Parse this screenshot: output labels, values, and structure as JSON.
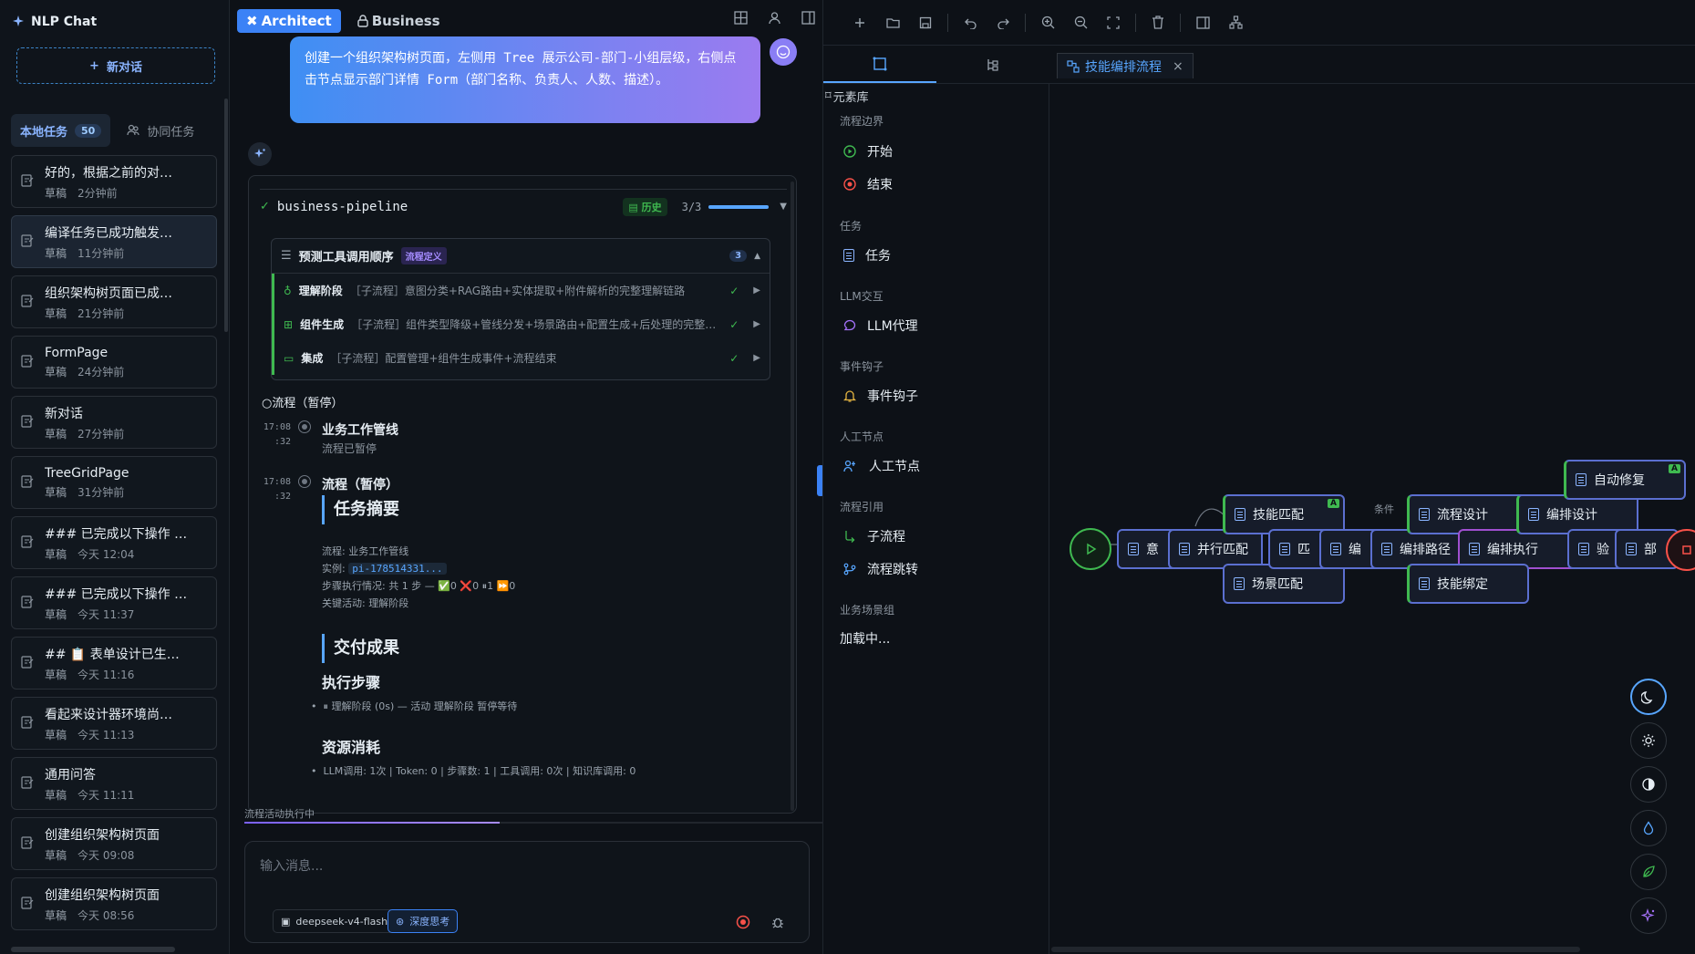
{
  "app": {
    "title": "NLP Chat"
  },
  "sidebar": {
    "new_chat": "新对话",
    "tabs": [
      {
        "label": "本地任务",
        "badge": "50"
      },
      {
        "label": "协同任务"
      }
    ],
    "conversations": [
      {
        "title": "好的，根据之前的对…",
        "status": "草稿",
        "time": "2分钟前"
      },
      {
        "title": "编译任务已成功触发…",
        "status": "草稿",
        "time": "11分钟前"
      },
      {
        "title": "组织架构树页面已成…",
        "status": "草稿",
        "time": "21分钟前"
      },
      {
        "title": "FormPage",
        "status": "草稿",
        "time": "24分钟前"
      },
      {
        "title": "新对话",
        "status": "草稿",
        "time": "27分钟前"
      },
      {
        "title": "TreeGridPage",
        "status": "草稿",
        "time": "31分钟前"
      },
      {
        "title": "### 已完成以下操作 …",
        "status": "草稿",
        "time": "今天 12:04"
      },
      {
        "title": "### 已完成以下操作 …",
        "status": "草稿",
        "time": "今天 11:37"
      },
      {
        "title": "## 📋 表单设计已生…",
        "status": "草稿",
        "time": "今天 11:16"
      },
      {
        "title": "看起来设计器环境尚…",
        "status": "草稿",
        "time": "今天 11:13"
      },
      {
        "title": "通用问答",
        "status": "草稿",
        "time": "今天 11:11"
      },
      {
        "title": "创建组织架构树页面",
        "status": "草稿",
        "time": "今天 09:08"
      },
      {
        "title": "创建组织架构树页面",
        "status": "草稿",
        "time": "今天 08:56"
      }
    ]
  },
  "chat": {
    "modes": [
      "Architect",
      "Business"
    ],
    "user_message": "创建一个组织架构树页面，左侧用 Tree 展示公司-部门-小组层级，右侧点击节点显示部门详情 Form（部门名称、负责人、人数、描述）。",
    "pipeline": {
      "name": "business-pipeline",
      "history_label": "历史",
      "progress_text": "3/3",
      "progress_fraction": 1.0,
      "tool_order": {
        "title": "预测工具调用顺序",
        "badge": "流程定义",
        "count": "3",
        "steps": [
          {
            "name": "理解阶段",
            "desc": "［子流程］意图分类+RAG路由+实体提取+附件解析的完整理解链路"
          },
          {
            "name": "组件生成",
            "desc": "［子流程］组件类型降级+管线分发+场景路由+配置生成+后处理的完整…"
          },
          {
            "name": "集成",
            "desc": "［子流程］配置管理+组件生成事件+流程结束"
          }
        ]
      },
      "flow_paused": "流程（暂停）",
      "timeline": [
        {
          "time": "17:08 :32",
          "title": "业务工作管线",
          "sub": "流程已暂停"
        },
        {
          "time": "17:08 :32",
          "title": "流程（暂停）",
          "sub": ""
        }
      ],
      "summary": {
        "h_task": "任务摘要",
        "flow_label": "流程: 业务工作管线",
        "instance_label": "实例:",
        "instance_id": "pi-178514331...",
        "steps_exec": "步骤执行情况: 共 1 步 — ✅0 ❌0 ⏸1 ⏩0",
        "key_activity": "关键活动: 理解阶段",
        "h_deliver": "交付成果",
        "h_steps": "执行步骤",
        "step_item": "⏸ 理解阶段 (0s) — 活动 理解阶段 暂停等待",
        "h_resource": "资源消耗",
        "resource_item": "LLM调用: 1次 | Token: 0 | 步骤数: 1 | 工具调用: 0次 | 知识库调用: 0"
      }
    },
    "status_line": "流程活动执行中",
    "input_placeholder": "输入消息...",
    "model": "deepseek-v4-flash",
    "deep_think": "深度思考"
  },
  "designer": {
    "palette_title": "元素库",
    "groups": [
      {
        "label": "流程边界",
        "items": [
          "开始",
          "结束"
        ]
      },
      {
        "label": "任务",
        "items": [
          "任务"
        ]
      },
      {
        "label": "LLM交互",
        "items": [
          "LLM代理"
        ]
      },
      {
        "label": "事件钩子",
        "items": [
          "事件钩子"
        ]
      },
      {
        "label": "人工节点",
        "items": [
          "人工节点"
        ]
      },
      {
        "label": "流程引用",
        "items": [
          "子流程",
          "流程跳转"
        ]
      },
      {
        "label": "业务场景组",
        "items": []
      }
    ],
    "loading": "加载中...",
    "canvas_tab": "技能编排流程",
    "nodes": [
      "意",
      "并行匹配",
      "技能匹配",
      "场景匹配",
      "匹",
      "编",
      "编排路径",
      "流程设计",
      "编排执行",
      "技能绑定",
      "编排设计",
      "自动修复",
      "验",
      "部"
    ],
    "edge_label": "条件",
    "node_badge": "A"
  }
}
